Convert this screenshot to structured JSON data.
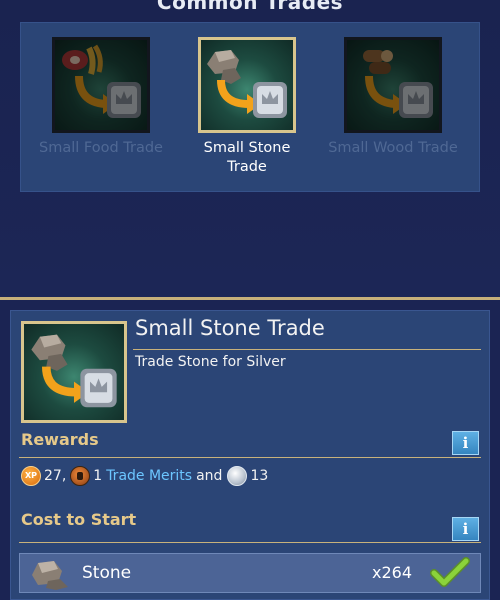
{
  "top": {
    "title": "Common Trades",
    "trades": [
      {
        "label": "Small Food Trade",
        "state": "unavailable"
      },
      {
        "label": "Small Stone Trade",
        "state": "selected"
      },
      {
        "label": "Small Wood Trade",
        "state": "unavailable"
      }
    ]
  },
  "detail": {
    "title": "Small Stone Trade",
    "description": "Trade Stone for Silver",
    "rewards_header": "Rewards",
    "rewards": {
      "xp_icon_text": "XP",
      "xp_value": "27,",
      "merit_value": "1",
      "merit_label": "Trade Merits",
      "and_text": "and",
      "silver_value": "13"
    },
    "cost_header": "Cost to Start",
    "info_label": "i",
    "cost": {
      "name": "Stone",
      "quantity": "x264",
      "met": true
    }
  },
  "colors": {
    "panel": "#2b4576",
    "background": "#1b2453",
    "gold_accent": "#c8b27b",
    "header_gold": "#e6c98a",
    "link_blue": "#6cc6ff",
    "check_green": "#8bd33a"
  },
  "icons": [
    "meat-icon",
    "wheat-icon",
    "stone-icon",
    "wood-log-icon",
    "silver-ingot-icon",
    "exchange-arrow-icon",
    "xp-coin-icon",
    "trade-merit-icon",
    "silver-coin-icon",
    "info-icon",
    "checkmark-icon"
  ]
}
